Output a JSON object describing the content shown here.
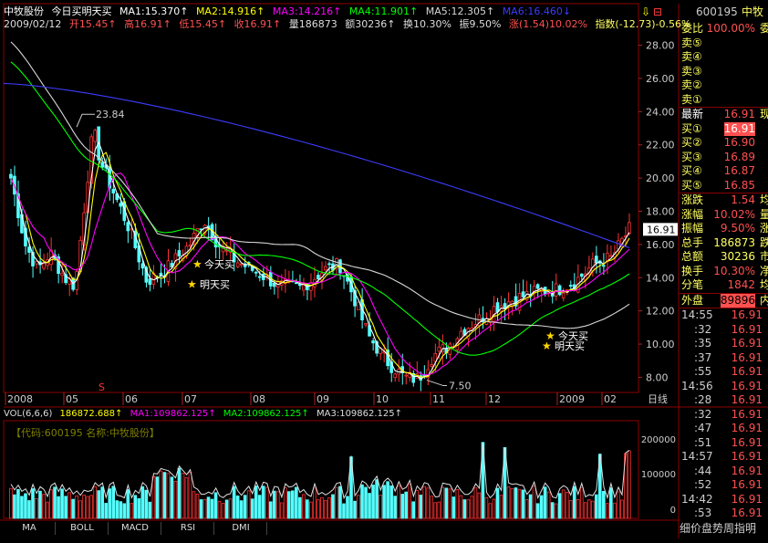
{
  "header": {
    "stock_name": "中牧股份",
    "indicator_name": "今日买明天买",
    "ma1": "MA1:15.370↑",
    "ma2": "MA2:14.916↑",
    "ma3": "MA3:14.216↑",
    "ma4": "MA4:11.901↑",
    "ma5": "MA5:12.305↑",
    "ma6": "MA6:16.460↓",
    "date": "2009/02/12",
    "open": "开15.45↑",
    "high": "高16.91↑",
    "low": "低15.45↑",
    "close": "收16.91↑",
    "volume": "量186873",
    "amount": "额30236↑",
    "turnover": "换10.30%",
    "amplitude": "振9.50%",
    "change": "涨(1.54)10.02%",
    "index": "指数(-12.73)-0.56%"
  },
  "colors": {
    "bg": "#000000",
    "up": "#ff3232",
    "down": "#54ffff",
    "ma1": "#ffffff",
    "ma2": "#ffff00",
    "ma3": "#ff00ff",
    "ma4": "#00ff00",
    "ma5": "#d7d7d7",
    "ma6": "#3c3cff",
    "grid": "#8b0000",
    "star": "#ffd700"
  },
  "price_axis": [
    "28.00",
    "26.00",
    "24.00",
    "22.00",
    "20.00",
    "18.00",
    "16.00",
    "14.00",
    "12.00",
    "10.00",
    "8.00"
  ],
  "price_marker": "16.91",
  "annotations": {
    "high_label": "23.84",
    "low_label": "7.50",
    "buy_today_1": "今天买",
    "buy_tomorrow_1": "明天买",
    "buy_today_2": "今天买",
    "buy_tomorrow_2": "明天买",
    "s_mark": "S"
  },
  "time_axis": [
    "2008",
    "05",
    "06",
    "07",
    "08",
    "09",
    "10",
    "11",
    "12",
    "2009",
    "02"
  ],
  "period_label": "日线",
  "vol_header": {
    "name": "VOL(6,6,6)",
    "vol": "186872.688↑",
    "ma1": "MA1:109862.125↑",
    "ma2": "MA2:109862.125↑",
    "ma3": "MA3:109862.125↑"
  },
  "vol_info": "【代码:600195 名称:中牧股份】",
  "vol_axis": [
    "200000",
    "100000",
    "0"
  ],
  "tabs": [
    "MA",
    "BOLL",
    "MACD",
    "RSI",
    "DMI"
  ],
  "side": {
    "code": "600195",
    "name": "中牧",
    "ratio_label": "委比",
    "ratio_value": "100.00%",
    "ratio_tail": "委",
    "asks": [
      "卖⑤",
      "卖④",
      "卖③",
      "卖②",
      "卖①"
    ],
    "latest_label": "最新",
    "latest_value": "16.91",
    "latest_tail": "现",
    "bids": [
      {
        "k": "买①",
        "v": "16.91"
      },
      {
        "k": "买②",
        "v": "16.90"
      },
      {
        "k": "买③",
        "v": "16.89"
      },
      {
        "k": "买④",
        "v": "16.87"
      },
      {
        "k": "买⑤",
        "v": "16.85"
      }
    ],
    "stats": [
      {
        "k": "涨跌",
        "v": "1.54",
        "x": "均"
      },
      {
        "k": "涨幅",
        "v": "10.02%",
        "x": "量"
      },
      {
        "k": "振幅",
        "v": "9.50%",
        "x": "涨"
      },
      {
        "k": "总手",
        "v": "186873",
        "x": "跌"
      },
      {
        "k": "总额",
        "v": "30236",
        "x": "市"
      },
      {
        "k": "换手",
        "v": "10.30%",
        "x": "净"
      },
      {
        "k": "分笔",
        "v": "1842",
        "x": "均"
      }
    ],
    "outer_label": "外盘",
    "outer_value": "89896",
    "outer_tail": "内",
    "ticks": [
      {
        "t": "14:55",
        "p": "16.91"
      },
      {
        "t": ":32",
        "p": "16.91"
      },
      {
        "t": ":35",
        "p": "16.91"
      },
      {
        "t": ":37",
        "p": "16.91"
      },
      {
        "t": ":55",
        "p": "16.91"
      },
      {
        "t": "14:56",
        "p": "16.91"
      },
      {
        "t": ":28",
        "p": "16.91"
      },
      {
        "t": ":32",
        "p": "16.91"
      },
      {
        "t": ":47",
        "p": "16.91"
      },
      {
        "t": ":51",
        "p": "16.91"
      },
      {
        "t": "14:57",
        "p": "16.91"
      },
      {
        "t": ":44",
        "p": "16.91"
      },
      {
        "t": ":52",
        "p": "16.91"
      },
      {
        "t": "14:42",
        "p": "16.91"
      },
      {
        "t": ":53",
        "p": "16.91"
      }
    ],
    "bottom_tabs": "细价盘势周指明"
  }
}
